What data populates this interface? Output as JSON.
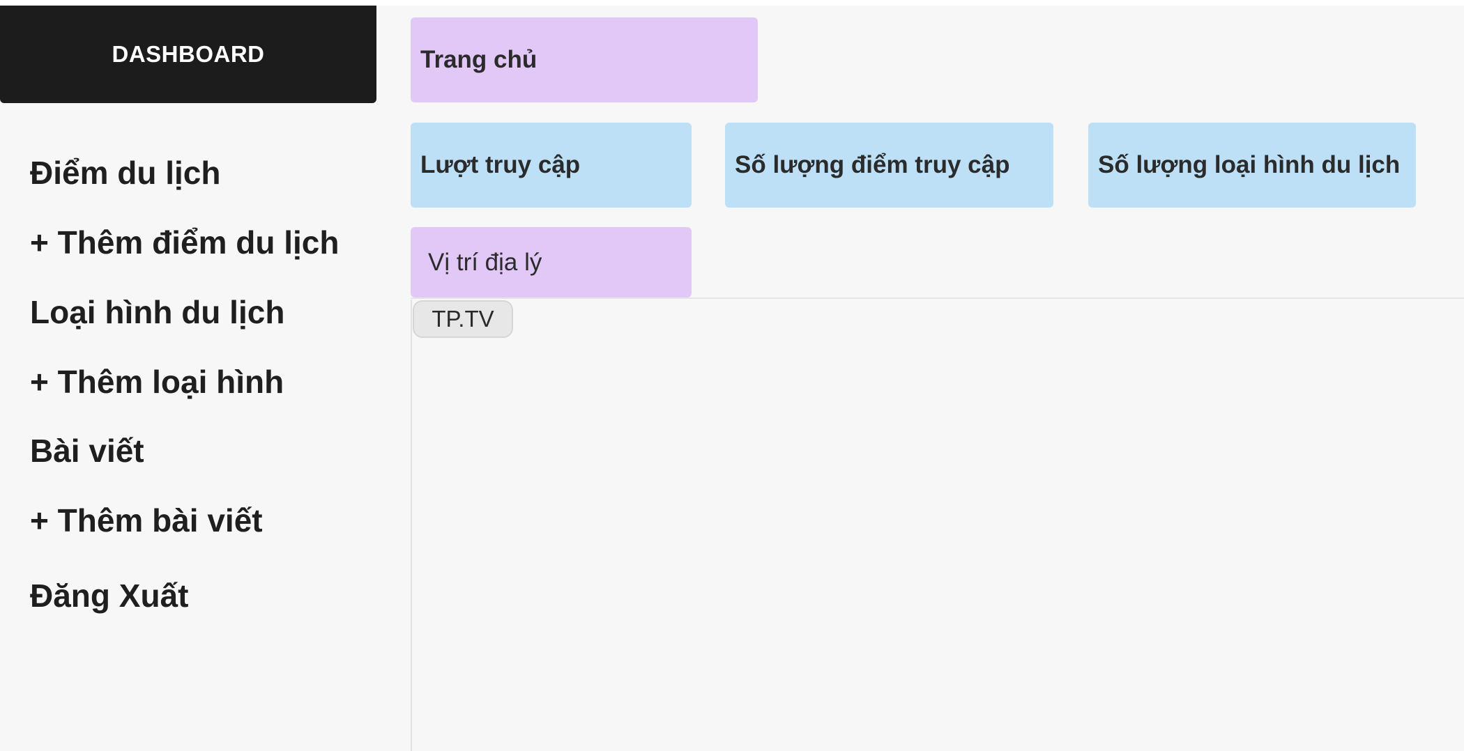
{
  "brand": {
    "label": "DASHBOARD"
  },
  "sidebar": {
    "items": [
      {
        "label": "Điểm du lịch"
      },
      {
        "label": "+ Thêm điểm du lịch"
      },
      {
        "label": "Loại hình du lịch"
      },
      {
        "label": "+ Thêm loại hình"
      },
      {
        "label": "Bài viết"
      },
      {
        "label": "+ Thêm bài viết"
      },
      {
        "label": "Đăng Xuất"
      }
    ]
  },
  "main": {
    "home_label": "Trang chủ",
    "stats": [
      {
        "label": "Lượt truy cập"
      },
      {
        "label": "Số lượng điểm truy cập"
      },
      {
        "label": "Số lượng loại hình du lịch"
      }
    ],
    "location_label": "Vị trí địa lý",
    "map": {
      "marker_label": "TP.TV"
    }
  },
  "colors": {
    "brand_bg": "#1c1c1c",
    "purple_card": "#e2c8f7",
    "blue_card": "#bde0f6",
    "page_bg": "#f7f7f7"
  }
}
